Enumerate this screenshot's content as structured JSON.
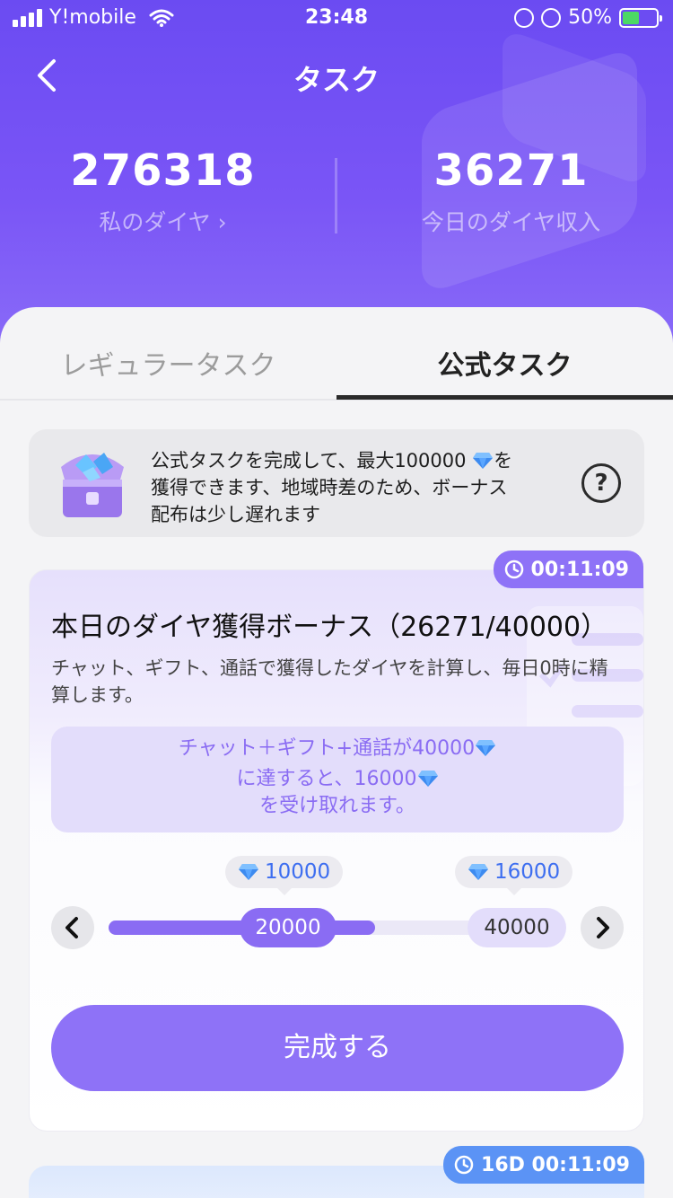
{
  "status_bar": {
    "carrier": "Y!mobile",
    "time": "23:48",
    "battery": "50%"
  },
  "header": {
    "title": "タスク"
  },
  "stats": [
    {
      "value": "276318",
      "label": "私のダイヤ ›"
    },
    {
      "value": "36271",
      "label": "今日のダイヤ収入"
    }
  ],
  "tabs": [
    {
      "label": "レギュラータスク",
      "active": false
    },
    {
      "label": "公式タスク",
      "active": true
    }
  ],
  "notice": {
    "line1_a": "公式タスクを完成して、最大100000 ",
    "line1_b": "を",
    "line2": "獲得できます、地域時差のため、ボーナス",
    "line3": "配布は少し遅れます",
    "help_label": "?"
  },
  "task_card": {
    "timer": "00:11:09",
    "title": "本日のダイヤ獲得ボーナス（26271/40000）",
    "description": "チャット、ギフト、通話で獲得したダイヤを計算し、毎日0時に精算します。",
    "condition_line1": "チャット＋ギフト+通話が40000",
    "condition_line2": "に達すると、16000",
    "condition_line3": "を受け取れます。",
    "milestones": [
      {
        "reward": "10000",
        "target": "20000",
        "completed": true
      },
      {
        "reward": "16000",
        "target": "40000",
        "completed": false
      }
    ],
    "progress_fraction": 0.59,
    "complete_button": "完成する"
  },
  "next_card": {
    "timer": "16D 00:11:09"
  },
  "colors": {
    "accent": "#8a6cf3",
    "header": "#6b4bf2",
    "gem": "#3d8bf0",
    "blue_timer": "#5b93f5"
  },
  "icons": [
    "back-icon",
    "diamond-icon",
    "help-icon",
    "clock-icon",
    "chevron-left-icon",
    "chevron-right-icon",
    "treasure-chest-icon"
  ]
}
